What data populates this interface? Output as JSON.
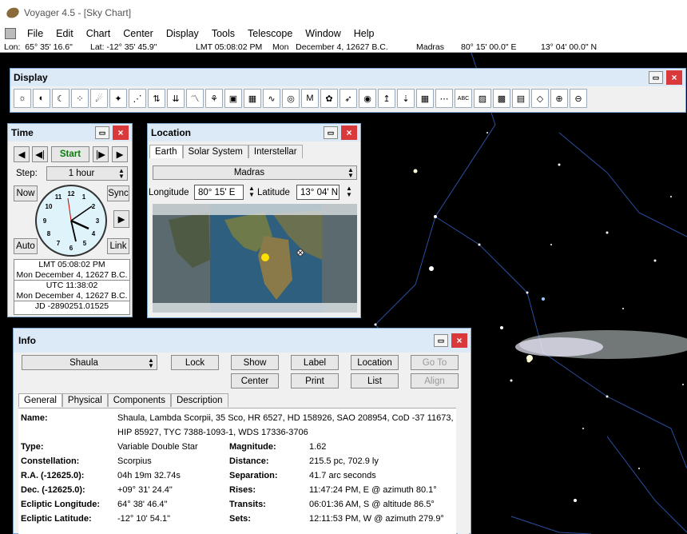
{
  "app": {
    "title": "Voyager 4.5 - [Sky Chart]"
  },
  "menu": [
    "File",
    "Edit",
    "Chart",
    "Center",
    "Display",
    "Tools",
    "Telescope",
    "Window",
    "Help"
  ],
  "status": {
    "lon": "Lon:  65° 35' 16.6\"",
    "lat": "Lat: -12° 35' 45.9\"",
    "lmt": "LMT 05:08:02 PM",
    "date": "Mon   December 4, 12627 B.C.",
    "place": "Madras",
    "plon": "80° 15' 00.0\" E",
    "plat": "13° 04' 00.0\" N"
  },
  "display": {
    "title": "Display",
    "icons": [
      "sun-icon",
      "planets-icon",
      "moon-icon",
      "stars-icon",
      "comet-icon",
      "meteor-icon",
      "star-cluster-icon",
      "up-down-arrows-icon",
      "down-arrows-icon",
      "constellation-lines-icon",
      "figure-icon",
      "boundary-icon",
      "grid-icon",
      "horizon-wave-icon",
      "binoculars-icon",
      "messier-icon",
      "nebula-icon",
      "galaxy-icon",
      "spiral-galaxy-icon",
      "ecliptic-icon",
      "equator-icon",
      "coordinate-grid-icon",
      "horizon-icon",
      "labels-icon",
      "image-icon",
      "palette-icon",
      "screen-icon",
      "eraser-icon",
      "zoom-in-icon",
      "zoom-out-icon"
    ]
  },
  "time": {
    "title": "Time",
    "start": "Start",
    "step_label": "Step:",
    "step": "1 hour",
    "now": "Now",
    "sync": "Sync",
    "auto": "Auto",
    "link": "Link",
    "lmt": "LMT 05:08:02 PM",
    "lmt_date": "Mon December 4, 12627 B.C.",
    "utc": "UTC 11:38:02",
    "utc_date": "Mon December 4, 12627 B.C.",
    "jd": "JD -2890251.01525"
  },
  "location": {
    "title": "Location",
    "tabs": [
      "Earth",
      "Solar System",
      "Interstellar"
    ],
    "place": "Madras",
    "lon_label": "Longitude",
    "lon": "80° 15' E",
    "lat_label": "Latitude",
    "lat": "13° 04' N"
  },
  "info": {
    "title": "Info",
    "object": "Shaula",
    "buttons": {
      "lock": "Lock",
      "show": "Show",
      "label": "Label",
      "location": "Location",
      "goto": "Go To",
      "center": "Center",
      "print": "Print",
      "list": "List",
      "align": "Align"
    },
    "tabs": [
      "General",
      "Physical",
      "Components",
      "Description"
    ],
    "name_label": "Name:",
    "name_value": "Shaula, Lambda Scorpii, 35 Sco, HR 6527, HD 158926, SAO 208954, CoD -37 11673,",
    "name_value2": "HIP 85927, TYC 7388-1093-1, WDS 17336-3706",
    "left_rows": [
      [
        "Type:",
        "Variable Double Star"
      ],
      [
        "Constellation:",
        "Scorpius"
      ],
      [
        "R.A. (-12625.0):",
        "04h 19m 32.74s"
      ],
      [
        "Dec. (-12625.0):",
        "+09° 31' 24.4\""
      ],
      [
        "Ecliptic Longitude:",
        "64° 38' 46.4\""
      ],
      [
        "Ecliptic Latitude:",
        "-12° 10' 54.1\""
      ]
    ],
    "right_rows": [
      [
        "Magnitude:",
        "1.62"
      ],
      [
        "Distance:",
        "215.5 pc, 702.9 ly"
      ],
      [
        "Separation:",
        "41.7 arc seconds"
      ],
      [
        "Rises:",
        "11:47:24 PM, E @ azimuth 80.1°"
      ],
      [
        "Transits:",
        "06:01:36 AM, S @ altitude 86.5°"
      ],
      [
        "Sets:",
        "12:11:53 PM, W @ azimuth 279.9°"
      ]
    ]
  }
}
